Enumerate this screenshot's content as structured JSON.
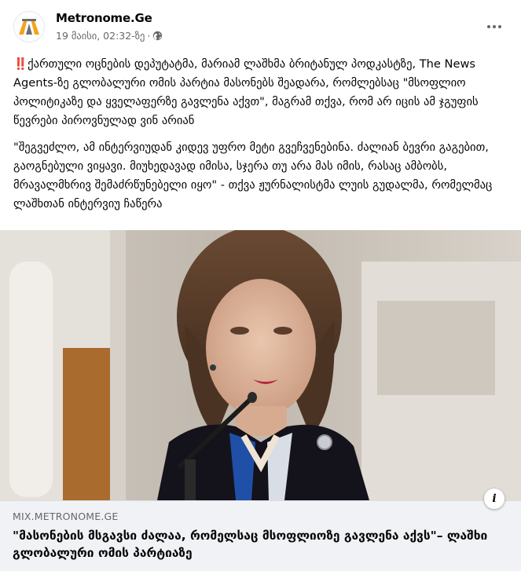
{
  "post": {
    "page_name": "Metronome.Ge",
    "timestamp": "19 მაისი, 02:32-ზე",
    "separator": "·",
    "emoji": "‼️",
    "paragraph1": "ქართული ოცნების დეპუტატმა, მარიამ ლაშხმა ბრიტანულ პოდკასტზე, The News Agents-ზე გლობალური ომის პარტია მასონებს შეადარა, რომლებსაც \"მსოფლიო პოლიტიკაზე და ყველაფერზე გავლენა აქვთ\", მაგრამ თქვა, რომ არ იცის ამ ჯგუფის წევრები პიროვნულად ვინ არიან",
    "paragraph2": " \"შეგვეძლო, ამ ინტერვიუდან კიდევ უფრო მეტი გვეჩვენებინა. ძალიან ბევრი გაგებით, გაოგნებული ვიყავი. მიუხედავად იმისა, სჯერა თუ არა მას იმის, რასაც ამბობს, მრავალმხრივ შემაძრწუნებელი იყო\" - თქვა ჟურნალისტმა ლუის გუდალმა, რომელმაც ლაშხთან ინტერვიუ ჩაწერა"
  },
  "link_preview": {
    "domain": "MIX.METRONOME.GE",
    "headline": "\"მასონების მსგავსი ძალაა, რომელსაც მსოფლიოზე გავლენა აქვს\"– ლაშხი გლობალური ომის პარტიაზე",
    "info_label": "i"
  },
  "icons": {
    "avatar": "metronome-logo-icon",
    "privacy": "globe-icon",
    "more": "more-horizontal-icon",
    "info": "info-icon"
  },
  "colors": {
    "logo_orange": "#f5a31a",
    "logo_gray": "#6b6f78",
    "meta_text": "#65676b",
    "link_bg": "#f0f2f5"
  }
}
